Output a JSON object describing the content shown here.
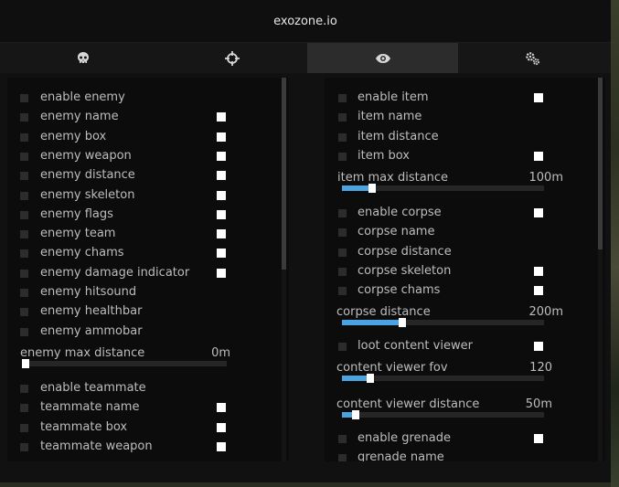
{
  "window": {
    "title": "exozone.io"
  },
  "tabs": [
    {
      "icon": "skull-icon",
      "active": false
    },
    {
      "icon": "crosshair-icon",
      "active": false
    },
    {
      "icon": "eye-icon",
      "active": true
    },
    {
      "icon": "gears-icon",
      "active": false
    }
  ],
  "colors": {
    "accent": "#4aa3e0",
    "panel": "#0c0c0c",
    "window": "#111111",
    "tab_active": "#2c2c2c",
    "swatch": "#ffffff"
  },
  "left_panel": {
    "enemy_toggles": [
      {
        "label": "enable enemy",
        "swatch": false
      },
      {
        "label": "enemy name",
        "swatch": true
      },
      {
        "label": "enemy box",
        "swatch": true
      },
      {
        "label": "enemy weapon",
        "swatch": true
      },
      {
        "label": "enemy distance",
        "swatch": true
      },
      {
        "label": "enemy skeleton",
        "swatch": true
      },
      {
        "label": "enemy flags",
        "swatch": true
      },
      {
        "label": "enemy team",
        "swatch": true
      },
      {
        "label": "enemy chams",
        "swatch": true
      },
      {
        "label": "enemy damage indicator",
        "swatch": true
      },
      {
        "label": "enemy hitsound",
        "swatch": false
      },
      {
        "label": "enemy healthbar",
        "swatch": false
      },
      {
        "label": "enemy ammobar",
        "swatch": false
      }
    ],
    "enemy_max_distance": {
      "label": "enemy max distance",
      "value": "0m",
      "fraction": 0.0
    },
    "teammate_toggles": [
      {
        "label": "enable teammate",
        "swatch": false
      },
      {
        "label": "teammate name",
        "swatch": true
      },
      {
        "label": "teammate box",
        "swatch": true
      },
      {
        "label": "teammate weapon",
        "swatch": true
      }
    ]
  },
  "right_panel": {
    "item_toggles": [
      {
        "label": "enable item",
        "swatch": true
      },
      {
        "label": "item name",
        "swatch": false
      },
      {
        "label": "item distance",
        "swatch": false
      },
      {
        "label": "item box",
        "swatch": true
      }
    ],
    "item_max_distance": {
      "label": "item max distance",
      "value": "100m",
      "fraction": 0.15
    },
    "corpse_toggles": [
      {
        "label": "enable corpse",
        "swatch": true
      },
      {
        "label": "corpse name",
        "swatch": false
      },
      {
        "label": "corpse distance",
        "swatch": false
      },
      {
        "label": "corpse skeleton",
        "swatch": true
      },
      {
        "label": "corpse chams",
        "swatch": true
      }
    ],
    "corpse_distance": {
      "label": "corpse distance",
      "value": "200m",
      "fraction": 0.3
    },
    "loot_toggles": [
      {
        "label": "loot content viewer",
        "swatch": true
      }
    ],
    "content_viewer_fov": {
      "label": "content viewer fov",
      "value": "120",
      "fraction": 0.14
    },
    "content_viewer_distance": {
      "label": "content viewer distance",
      "value": "50m",
      "fraction": 0.07
    },
    "grenade_toggles": [
      {
        "label": "enable grenade",
        "swatch": true
      },
      {
        "label": "grenade name",
        "swatch": false
      }
    ]
  }
}
